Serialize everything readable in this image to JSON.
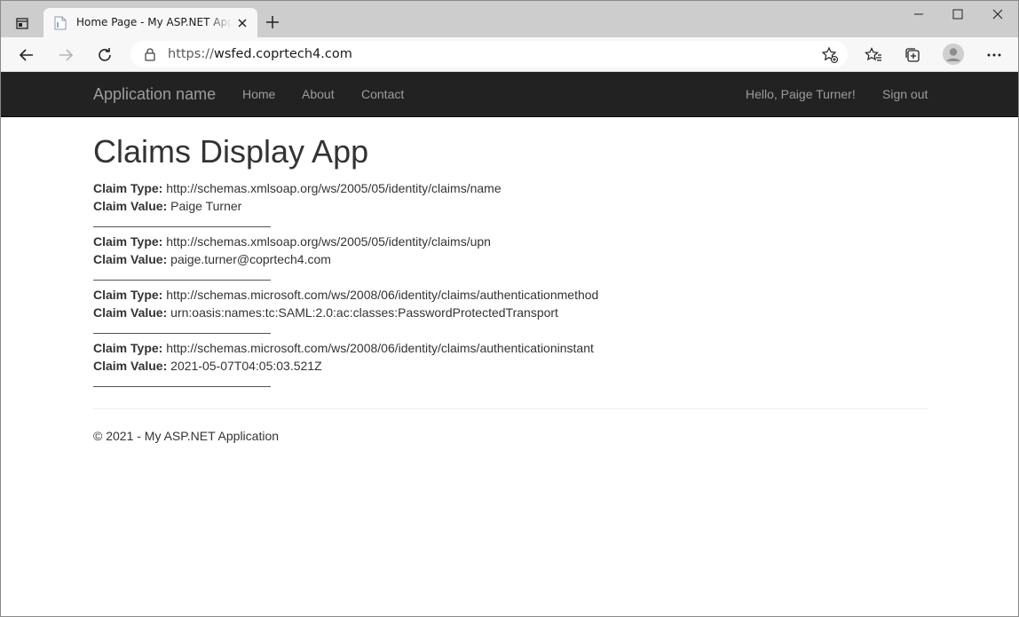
{
  "browser": {
    "tab_title": "Home Page - My ASP.NET Application",
    "url_scheme": "https://",
    "url_host": "wsfed.coprtech4.com"
  },
  "navbar": {
    "brand": "Application name",
    "links": [
      "Home",
      "About",
      "Contact"
    ],
    "greeting": "Hello, Paige Turner!",
    "sign_out": "Sign out"
  },
  "main": {
    "title": "Claims Display App",
    "type_label": "Claim Type:",
    "value_label": "Claim Value:",
    "claims": [
      {
        "type": "http://schemas.xmlsoap.org/ws/2005/05/identity/claims/name",
        "value": "Paige Turner"
      },
      {
        "type": "http://schemas.xmlsoap.org/ws/2005/05/identity/claims/upn",
        "value": "paige.turner@coprtech4.com"
      },
      {
        "type": "http://schemas.microsoft.com/ws/2008/06/identity/claims/authenticationmethod",
        "value": "urn:oasis:names:tc:SAML:2.0:ac:classes:PasswordProtectedTransport"
      },
      {
        "type": "http://schemas.microsoft.com/ws/2008/06/identity/claims/authenticationinstant",
        "value": "2021-05-07T04:05:03.521Z"
      }
    ]
  },
  "footer": {
    "text": "© 2021 - My ASP.NET Application"
  },
  "colors": {
    "navbar_bg": "#222222",
    "nav_text": "#9d9d9d",
    "body_text": "#333333"
  },
  "icons": [
    "tab-actions-icon",
    "page-favicon-icon",
    "close-icon",
    "plus-icon",
    "minimize-icon",
    "maximize-icon",
    "window-close-icon",
    "back-icon",
    "forward-icon",
    "refresh-icon",
    "lock-icon",
    "add-favorite-icon",
    "favorites-icon",
    "collections-icon",
    "profile-icon",
    "more-icon"
  ]
}
